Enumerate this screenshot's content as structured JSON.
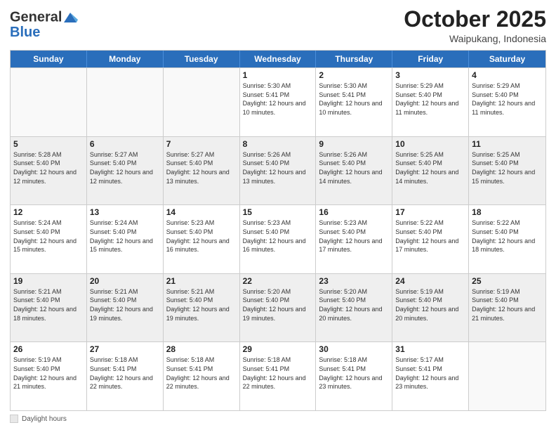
{
  "header": {
    "logo_general": "General",
    "logo_blue": "Blue",
    "month_title": "October 2025",
    "location": "Waipukang, Indonesia"
  },
  "days_of_week": [
    "Sunday",
    "Monday",
    "Tuesday",
    "Wednesday",
    "Thursday",
    "Friday",
    "Saturday"
  ],
  "footer": {
    "label": "Daylight hours"
  },
  "weeks": [
    [
      {
        "day": "",
        "empty": true
      },
      {
        "day": "",
        "empty": true
      },
      {
        "day": "",
        "empty": true
      },
      {
        "day": "1",
        "sunrise": "Sunrise: 5:30 AM",
        "sunset": "Sunset: 5:41 PM",
        "daylight": "Daylight: 12 hours and 10 minutes."
      },
      {
        "day": "2",
        "sunrise": "Sunrise: 5:30 AM",
        "sunset": "Sunset: 5:41 PM",
        "daylight": "Daylight: 12 hours and 10 minutes."
      },
      {
        "day": "3",
        "sunrise": "Sunrise: 5:29 AM",
        "sunset": "Sunset: 5:40 PM",
        "daylight": "Daylight: 12 hours and 11 minutes."
      },
      {
        "day": "4",
        "sunrise": "Sunrise: 5:29 AM",
        "sunset": "Sunset: 5:40 PM",
        "daylight": "Daylight: 12 hours and 11 minutes."
      }
    ],
    [
      {
        "day": "5",
        "sunrise": "Sunrise: 5:28 AM",
        "sunset": "Sunset: 5:40 PM",
        "daylight": "Daylight: 12 hours and 12 minutes."
      },
      {
        "day": "6",
        "sunrise": "Sunrise: 5:27 AM",
        "sunset": "Sunset: 5:40 PM",
        "daylight": "Daylight: 12 hours and 12 minutes."
      },
      {
        "day": "7",
        "sunrise": "Sunrise: 5:27 AM",
        "sunset": "Sunset: 5:40 PM",
        "daylight": "Daylight: 12 hours and 13 minutes."
      },
      {
        "day": "8",
        "sunrise": "Sunrise: 5:26 AM",
        "sunset": "Sunset: 5:40 PM",
        "daylight": "Daylight: 12 hours and 13 minutes."
      },
      {
        "day": "9",
        "sunrise": "Sunrise: 5:26 AM",
        "sunset": "Sunset: 5:40 PM",
        "daylight": "Daylight: 12 hours and 14 minutes."
      },
      {
        "day": "10",
        "sunrise": "Sunrise: 5:25 AM",
        "sunset": "Sunset: 5:40 PM",
        "daylight": "Daylight: 12 hours and 14 minutes."
      },
      {
        "day": "11",
        "sunrise": "Sunrise: 5:25 AM",
        "sunset": "Sunset: 5:40 PM",
        "daylight": "Daylight: 12 hours and 15 minutes."
      }
    ],
    [
      {
        "day": "12",
        "sunrise": "Sunrise: 5:24 AM",
        "sunset": "Sunset: 5:40 PM",
        "daylight": "Daylight: 12 hours and 15 minutes."
      },
      {
        "day": "13",
        "sunrise": "Sunrise: 5:24 AM",
        "sunset": "Sunset: 5:40 PM",
        "daylight": "Daylight: 12 hours and 15 minutes."
      },
      {
        "day": "14",
        "sunrise": "Sunrise: 5:23 AM",
        "sunset": "Sunset: 5:40 PM",
        "daylight": "Daylight: 12 hours and 16 minutes."
      },
      {
        "day": "15",
        "sunrise": "Sunrise: 5:23 AM",
        "sunset": "Sunset: 5:40 PM",
        "daylight": "Daylight: 12 hours and 16 minutes."
      },
      {
        "day": "16",
        "sunrise": "Sunrise: 5:23 AM",
        "sunset": "Sunset: 5:40 PM",
        "daylight": "Daylight: 12 hours and 17 minutes."
      },
      {
        "day": "17",
        "sunrise": "Sunrise: 5:22 AM",
        "sunset": "Sunset: 5:40 PM",
        "daylight": "Daylight: 12 hours and 17 minutes."
      },
      {
        "day": "18",
        "sunrise": "Sunrise: 5:22 AM",
        "sunset": "Sunset: 5:40 PM",
        "daylight": "Daylight: 12 hours and 18 minutes."
      }
    ],
    [
      {
        "day": "19",
        "sunrise": "Sunrise: 5:21 AM",
        "sunset": "Sunset: 5:40 PM",
        "daylight": "Daylight: 12 hours and 18 minutes."
      },
      {
        "day": "20",
        "sunrise": "Sunrise: 5:21 AM",
        "sunset": "Sunset: 5:40 PM",
        "daylight": "Daylight: 12 hours and 19 minutes."
      },
      {
        "day": "21",
        "sunrise": "Sunrise: 5:21 AM",
        "sunset": "Sunset: 5:40 PM",
        "daylight": "Daylight: 12 hours and 19 minutes."
      },
      {
        "day": "22",
        "sunrise": "Sunrise: 5:20 AM",
        "sunset": "Sunset: 5:40 PM",
        "daylight": "Daylight: 12 hours and 19 minutes."
      },
      {
        "day": "23",
        "sunrise": "Sunrise: 5:20 AM",
        "sunset": "Sunset: 5:40 PM",
        "daylight": "Daylight: 12 hours and 20 minutes."
      },
      {
        "day": "24",
        "sunrise": "Sunrise: 5:19 AM",
        "sunset": "Sunset: 5:40 PM",
        "daylight": "Daylight: 12 hours and 20 minutes."
      },
      {
        "day": "25",
        "sunrise": "Sunrise: 5:19 AM",
        "sunset": "Sunset: 5:40 PM",
        "daylight": "Daylight: 12 hours and 21 minutes."
      }
    ],
    [
      {
        "day": "26",
        "sunrise": "Sunrise: 5:19 AM",
        "sunset": "Sunset: 5:40 PM",
        "daylight": "Daylight: 12 hours and 21 minutes."
      },
      {
        "day": "27",
        "sunrise": "Sunrise: 5:18 AM",
        "sunset": "Sunset: 5:41 PM",
        "daylight": "Daylight: 12 hours and 22 minutes."
      },
      {
        "day": "28",
        "sunrise": "Sunrise: 5:18 AM",
        "sunset": "Sunset: 5:41 PM",
        "daylight": "Daylight: 12 hours and 22 minutes."
      },
      {
        "day": "29",
        "sunrise": "Sunrise: 5:18 AM",
        "sunset": "Sunset: 5:41 PM",
        "daylight": "Daylight: 12 hours and 22 minutes."
      },
      {
        "day": "30",
        "sunrise": "Sunrise: 5:18 AM",
        "sunset": "Sunset: 5:41 PM",
        "daylight": "Daylight: 12 hours and 23 minutes."
      },
      {
        "day": "31",
        "sunrise": "Sunrise: 5:17 AM",
        "sunset": "Sunset: 5:41 PM",
        "daylight": "Daylight: 12 hours and 23 minutes."
      },
      {
        "day": "",
        "empty": true
      }
    ]
  ]
}
